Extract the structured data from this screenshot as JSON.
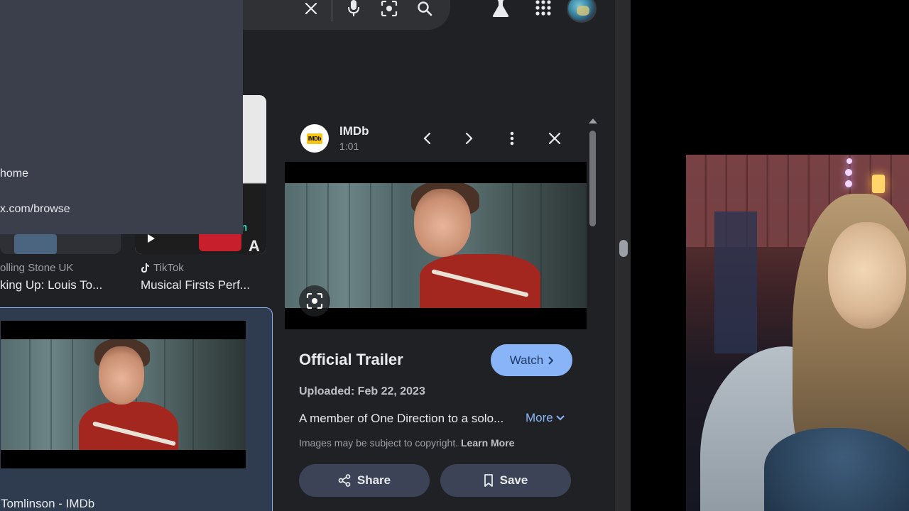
{
  "dropdown": {
    "item_home": "home",
    "item_browse": "x.com/browse"
  },
  "results": {
    "left_source": "olling Stone UK",
    "left_title": "king Up: Louis To...",
    "right_source": "TikTok",
    "right_title": "Musical Firsts Perf...",
    "right_overlay_text": "on",
    "right_overlay_letter": "A",
    "selected_caption": "Tomlinson - IMDb"
  },
  "panel": {
    "source": "IMDb",
    "logo_text": "IMDb",
    "duration": "1:01",
    "title": "Official Trailer",
    "watch_label": "Watch",
    "uploaded_label": "Uploaded:",
    "uploaded_date": "Feb 22, 2023",
    "description": "A member of One Direction to a solo...",
    "more_label": "More",
    "copyright_text": "Images may be subject to copyright.",
    "learn_more": "Learn More",
    "share_label": "Share",
    "save_label": "Save"
  },
  "colors": {
    "accent": "#8ab4f8",
    "panel_bg": "#202124",
    "dropdown_bg": "#3b3e4b",
    "pill_bg": "#3c4356",
    "imdb_yellow": "#f5c518"
  },
  "icons": {
    "clear": "close-icon",
    "voice": "microphone-icon",
    "lens": "camera-lens-icon",
    "search": "search-icon",
    "labs": "flask-icon",
    "apps": "apps-grid-icon"
  }
}
